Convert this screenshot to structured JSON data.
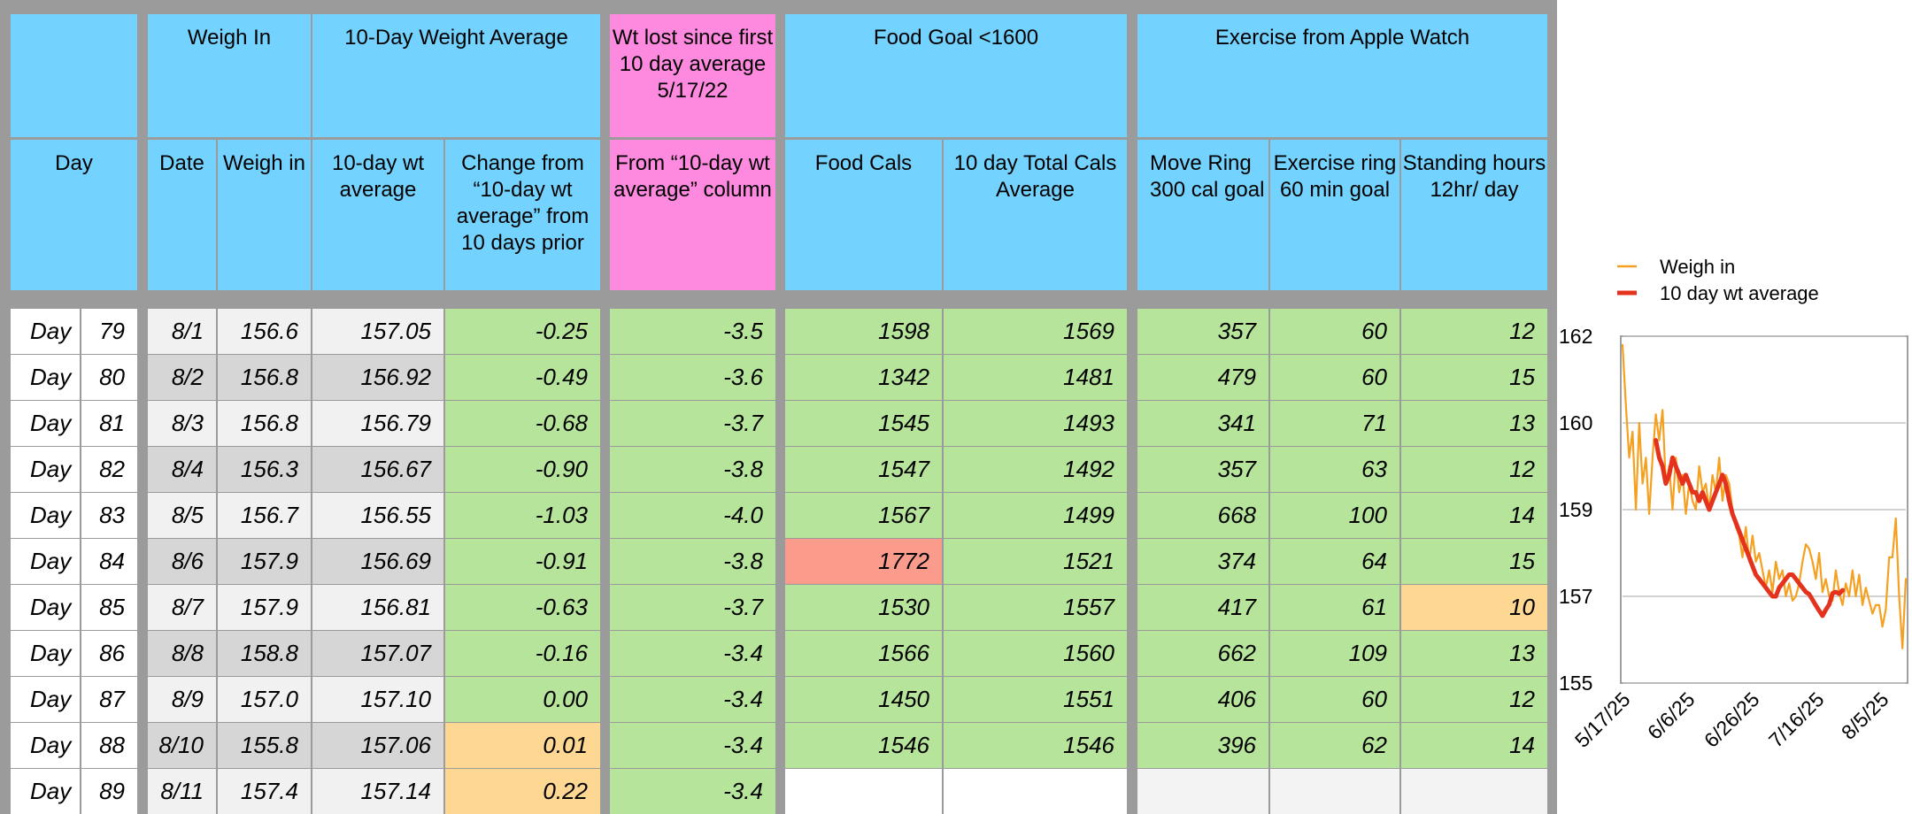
{
  "colors": {
    "header": "#73d3fe",
    "header_pink": "#fe8ae0",
    "good": "#b5e49a",
    "over_goal": "#fa9b8b",
    "warning": "#fed793",
    "weigh_in_line": "#f5a020",
    "avg_line": "#e4321c"
  },
  "header": {
    "group_weigh_in": "Weigh In",
    "group_avg": "10-Day Weight Average",
    "group_lost": "Wt lost since first 10 day average 5/17/22",
    "group_food": "Food Goal <1600",
    "group_exercise": "Exercise from Apple Watch",
    "col_day": "Day",
    "col_date": "Date",
    "col_weigh": "Weigh in",
    "col_avg": "10-day wt average",
    "col_change": "Change from “10-day wt average” from 10 days prior",
    "col_from": "From “10-day wt average” column",
    "col_food": "Food Cals",
    "col_food_avg": "10 day Total Cals Average",
    "col_move": "Move Ring 300 cal goal",
    "col_exercise": "Exercise ring 60 min goal",
    "col_standing": "Standing hours 12hr/ day"
  },
  "rows": [
    {
      "label": "Day",
      "num": "79",
      "date": "8/1",
      "weigh": "156.6",
      "avg": "157.05",
      "change": "-0.25",
      "change_flag": "good",
      "lost": "-3.5",
      "food": "1598",
      "food_flag": "good",
      "food_avg": "1569",
      "move": "357",
      "exercise": "60",
      "stand": "12",
      "stand_flag": "good"
    },
    {
      "label": "Day",
      "num": "80",
      "date": "8/2",
      "weigh": "156.8",
      "avg": "156.92",
      "change": "-0.49",
      "change_flag": "good",
      "lost": "-3.6",
      "food": "1342",
      "food_flag": "good",
      "food_avg": "1481",
      "move": "479",
      "exercise": "60",
      "stand": "15",
      "stand_flag": "good"
    },
    {
      "label": "Day",
      "num": "81",
      "date": "8/3",
      "weigh": "156.8",
      "avg": "156.79",
      "change": "-0.68",
      "change_flag": "good",
      "lost": "-3.7",
      "food": "1545",
      "food_flag": "good",
      "food_avg": "1493",
      "move": "341",
      "exercise": "71",
      "stand": "13",
      "stand_flag": "good"
    },
    {
      "label": "Day",
      "num": "82",
      "date": "8/4",
      "weigh": "156.3",
      "avg": "156.67",
      "change": "-0.90",
      "change_flag": "good",
      "lost": "-3.8",
      "food": "1547",
      "food_flag": "good",
      "food_avg": "1492",
      "move": "357",
      "exercise": "63",
      "stand": "12",
      "stand_flag": "good"
    },
    {
      "label": "Day",
      "num": "83",
      "date": "8/5",
      "weigh": "156.7",
      "avg": "156.55",
      "change": "-1.03",
      "change_flag": "good",
      "lost": "-4.0",
      "food": "1567",
      "food_flag": "good",
      "food_avg": "1499",
      "move": "668",
      "exercise": "100",
      "stand": "14",
      "stand_flag": "good"
    },
    {
      "label": "Day",
      "num": "84",
      "date": "8/6",
      "weigh": "157.9",
      "avg": "156.69",
      "change": "-0.91",
      "change_flag": "good",
      "lost": "-3.8",
      "food": "1772",
      "food_flag": "over",
      "food_avg": "1521",
      "move": "374",
      "exercise": "64",
      "stand": "15",
      "stand_flag": "good"
    },
    {
      "label": "Day",
      "num": "85",
      "date": "8/7",
      "weigh": "157.9",
      "avg": "156.81",
      "change": "-0.63",
      "change_flag": "good",
      "lost": "-3.7",
      "food": "1530",
      "food_flag": "good",
      "food_avg": "1557",
      "move": "417",
      "exercise": "61",
      "stand": "10",
      "stand_flag": "warn"
    },
    {
      "label": "Day",
      "num": "86",
      "date": "8/8",
      "weigh": "158.8",
      "avg": "157.07",
      "change": "-0.16",
      "change_flag": "good",
      "lost": "-3.4",
      "food": "1566",
      "food_flag": "good",
      "food_avg": "1560",
      "move": "662",
      "exercise": "109",
      "stand": "13",
      "stand_flag": "good"
    },
    {
      "label": "Day",
      "num": "87",
      "date": "8/9",
      "weigh": "157.0",
      "avg": "157.10",
      "change": "0.00",
      "change_flag": "good",
      "lost": "-3.4",
      "food": "1450",
      "food_flag": "good",
      "food_avg": "1551",
      "move": "406",
      "exercise": "60",
      "stand": "12",
      "stand_flag": "good"
    },
    {
      "label": "Day",
      "num": "88",
      "date": "8/10",
      "weigh": "155.8",
      "avg": "157.06",
      "change": "0.01",
      "change_flag": "warn",
      "lost": "-3.4",
      "food": "1546",
      "food_flag": "good",
      "food_avg": "1546",
      "move": "396",
      "exercise": "62",
      "stand": "14",
      "stand_flag": "good"
    },
    {
      "label": "Day",
      "num": "89",
      "date": "8/11",
      "weigh": "157.4",
      "avg": "157.14",
      "change": "0.22",
      "change_flag": "warn",
      "lost": "-3.4",
      "food": "",
      "food_flag": "empty",
      "food_avg": "",
      "move": "",
      "exercise": "",
      "stand": "",
      "stand_flag": "empty"
    }
  ],
  "chart_data": {
    "type": "line",
    "legend": [
      "Weigh in",
      "10 day wt average"
    ],
    "legend_position": "top",
    "yticks": [
      "155",
      "157",
      "159",
      "160",
      "162"
    ],
    "ylim": [
      155,
      162
    ],
    "xticks": [
      "5/17/25",
      "6/6/25",
      "6/26/25",
      "7/16/25",
      "8/5/25"
    ],
    "grid": true,
    "series": [
      {
        "name": "Weigh in",
        "values": [
          161.8,
          160.4,
          159.6,
          159.9,
          159.0,
          160.0,
          159.3,
          159.6,
          158.9,
          159.6,
          160.2,
          159.8,
          160.3,
          159.3,
          159.5,
          159.0,
          159.6,
          159.2,
          159.4,
          158.9,
          159.3,
          159.1,
          159.0,
          159.5,
          159.2,
          159.3,
          159.0,
          159.4,
          159.2,
          159.6,
          159.1,
          159.4,
          159.3,
          159.0,
          158.6,
          158.4,
          157.9,
          158.6,
          157.8,
          158.4,
          157.8,
          158.0,
          157.6,
          157.2,
          157.6,
          157.1,
          157.8,
          157.4,
          157.6,
          157.0,
          157.3,
          156.9,
          157.0,
          157.3,
          157.8,
          158.2,
          158.1,
          157.8,
          157.4,
          158.0,
          157.1,
          157.4,
          157.0,
          156.9,
          157.6,
          157.1,
          156.8,
          157.3,
          157.0,
          157.6,
          157.0,
          157.5,
          156.8,
          157.2,
          156.9,
          156.6,
          156.8,
          156.8,
          156.3,
          156.7,
          157.9,
          157.9,
          158.8,
          157.0,
          155.8,
          157.4
        ]
      },
      {
        "name": "10 day wt average",
        "start_index": 10,
        "values": [
          159.8,
          159.6,
          159.5,
          159.3,
          159.4,
          159.6,
          159.5,
          159.4,
          159.3,
          159.4,
          159.3,
          159.2,
          159.2,
          159.1,
          159.2,
          159.1,
          159.0,
          159.1,
          159.2,
          159.3,
          159.4,
          159.3,
          159.1,
          158.9,
          158.7,
          158.5,
          158.3,
          158.1,
          157.9,
          157.7,
          157.5,
          157.4,
          157.3,
          157.2,
          157.1,
          157.0,
          157.0,
          157.2,
          157.3,
          157.4,
          157.5,
          157.5,
          157.4,
          157.3,
          157.2,
          157.1,
          157.05,
          156.92,
          156.79,
          156.67,
          156.55,
          156.69,
          156.81,
          157.07,
          157.1,
          157.06,
          157.14
        ]
      }
    ]
  }
}
